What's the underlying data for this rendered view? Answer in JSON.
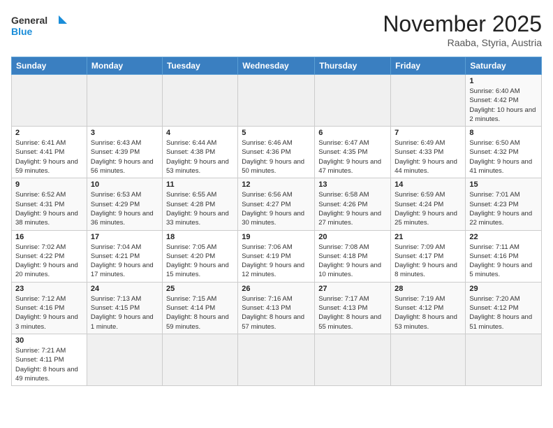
{
  "logo": {
    "text_general": "General",
    "text_blue": "Blue"
  },
  "title": "November 2025",
  "location": "Raaba, Styria, Austria",
  "weekdays": [
    "Sunday",
    "Monday",
    "Tuesday",
    "Wednesday",
    "Thursday",
    "Friday",
    "Saturday"
  ],
  "weeks": [
    [
      null,
      null,
      null,
      null,
      null,
      null,
      {
        "day": 1,
        "sunrise": "6:40 AM",
        "sunset": "4:42 PM",
        "daylight": "10 hours and 2 minutes."
      }
    ],
    [
      {
        "day": 2,
        "sunrise": "6:41 AM",
        "sunset": "4:41 PM",
        "daylight": "9 hours and 59 minutes."
      },
      {
        "day": 3,
        "sunrise": "6:43 AM",
        "sunset": "4:39 PM",
        "daylight": "9 hours and 56 minutes."
      },
      {
        "day": 4,
        "sunrise": "6:44 AM",
        "sunset": "4:38 PM",
        "daylight": "9 hours and 53 minutes."
      },
      {
        "day": 5,
        "sunrise": "6:46 AM",
        "sunset": "4:36 PM",
        "daylight": "9 hours and 50 minutes."
      },
      {
        "day": 6,
        "sunrise": "6:47 AM",
        "sunset": "4:35 PM",
        "daylight": "9 hours and 47 minutes."
      },
      {
        "day": 7,
        "sunrise": "6:49 AM",
        "sunset": "4:33 PM",
        "daylight": "9 hours and 44 minutes."
      },
      {
        "day": 8,
        "sunrise": "6:50 AM",
        "sunset": "4:32 PM",
        "daylight": "9 hours and 41 minutes."
      }
    ],
    [
      {
        "day": 9,
        "sunrise": "6:52 AM",
        "sunset": "4:31 PM",
        "daylight": "9 hours and 38 minutes."
      },
      {
        "day": 10,
        "sunrise": "6:53 AM",
        "sunset": "4:29 PM",
        "daylight": "9 hours and 36 minutes."
      },
      {
        "day": 11,
        "sunrise": "6:55 AM",
        "sunset": "4:28 PM",
        "daylight": "9 hours and 33 minutes."
      },
      {
        "day": 12,
        "sunrise": "6:56 AM",
        "sunset": "4:27 PM",
        "daylight": "9 hours and 30 minutes."
      },
      {
        "day": 13,
        "sunrise": "6:58 AM",
        "sunset": "4:26 PM",
        "daylight": "9 hours and 27 minutes."
      },
      {
        "day": 14,
        "sunrise": "6:59 AM",
        "sunset": "4:24 PM",
        "daylight": "9 hours and 25 minutes."
      },
      {
        "day": 15,
        "sunrise": "7:01 AM",
        "sunset": "4:23 PM",
        "daylight": "9 hours and 22 minutes."
      }
    ],
    [
      {
        "day": 16,
        "sunrise": "7:02 AM",
        "sunset": "4:22 PM",
        "daylight": "9 hours and 20 minutes."
      },
      {
        "day": 17,
        "sunrise": "7:04 AM",
        "sunset": "4:21 PM",
        "daylight": "9 hours and 17 minutes."
      },
      {
        "day": 18,
        "sunrise": "7:05 AM",
        "sunset": "4:20 PM",
        "daylight": "9 hours and 15 minutes."
      },
      {
        "day": 19,
        "sunrise": "7:06 AM",
        "sunset": "4:19 PM",
        "daylight": "9 hours and 12 minutes."
      },
      {
        "day": 20,
        "sunrise": "7:08 AM",
        "sunset": "4:18 PM",
        "daylight": "9 hours and 10 minutes."
      },
      {
        "day": 21,
        "sunrise": "7:09 AM",
        "sunset": "4:17 PM",
        "daylight": "9 hours and 8 minutes."
      },
      {
        "day": 22,
        "sunrise": "7:11 AM",
        "sunset": "4:16 PM",
        "daylight": "9 hours and 5 minutes."
      }
    ],
    [
      {
        "day": 23,
        "sunrise": "7:12 AM",
        "sunset": "4:16 PM",
        "daylight": "9 hours and 3 minutes."
      },
      {
        "day": 24,
        "sunrise": "7:13 AM",
        "sunset": "4:15 PM",
        "daylight": "9 hours and 1 minute."
      },
      {
        "day": 25,
        "sunrise": "7:15 AM",
        "sunset": "4:14 PM",
        "daylight": "8 hours and 59 minutes."
      },
      {
        "day": 26,
        "sunrise": "7:16 AM",
        "sunset": "4:13 PM",
        "daylight": "8 hours and 57 minutes."
      },
      {
        "day": 27,
        "sunrise": "7:17 AM",
        "sunset": "4:13 PM",
        "daylight": "8 hours and 55 minutes."
      },
      {
        "day": 28,
        "sunrise": "7:19 AM",
        "sunset": "4:12 PM",
        "daylight": "8 hours and 53 minutes."
      },
      {
        "day": 29,
        "sunrise": "7:20 AM",
        "sunset": "4:12 PM",
        "daylight": "8 hours and 51 minutes."
      }
    ],
    [
      {
        "day": 30,
        "sunrise": "7:21 AM",
        "sunset": "4:11 PM",
        "daylight": "8 hours and 49 minutes."
      },
      null,
      null,
      null,
      null,
      null,
      null
    ]
  ]
}
